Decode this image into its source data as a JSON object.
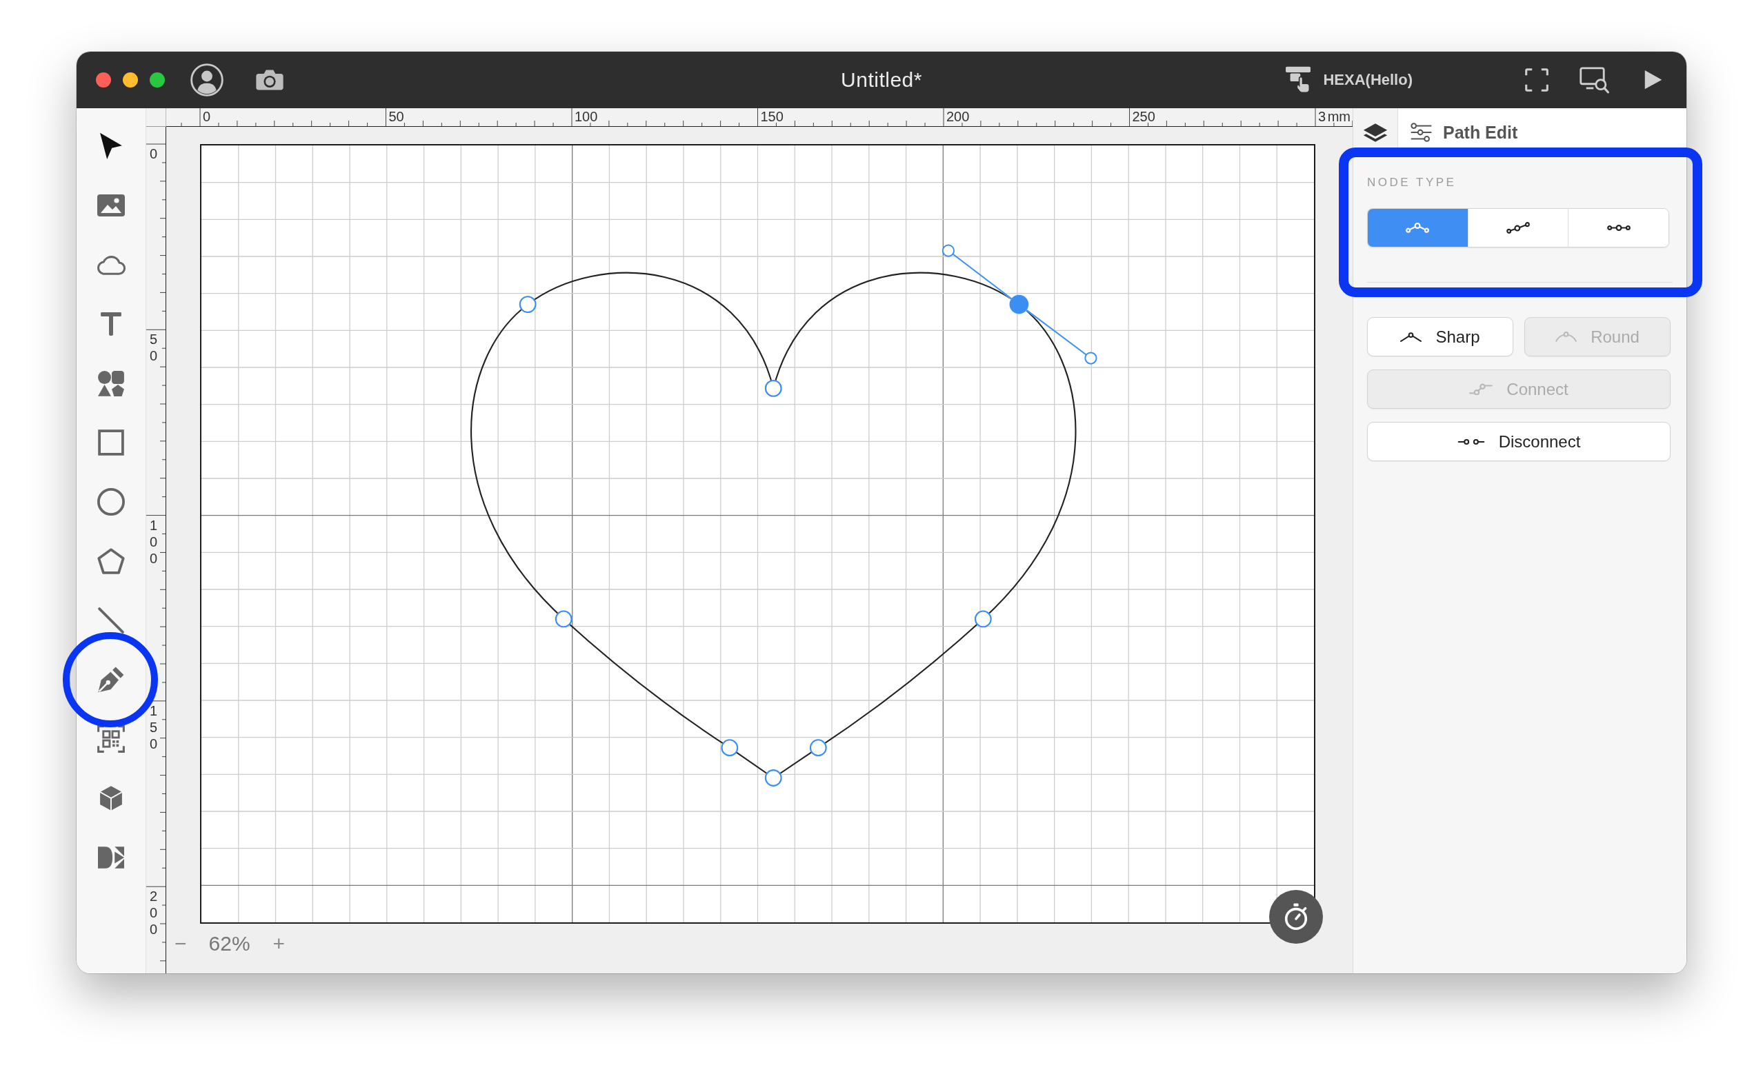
{
  "window": {
    "title": "Untitled*",
    "device": "HEXA(Hello)"
  },
  "tools": [
    {
      "kind": "pointer",
      "highlighted": false
    },
    {
      "kind": "image",
      "highlighted": false
    },
    {
      "kind": "cloud",
      "highlighted": false
    },
    {
      "kind": "text",
      "highlighted": false
    },
    {
      "kind": "shapes",
      "highlighted": false
    },
    {
      "kind": "rectangle",
      "highlighted": false
    },
    {
      "kind": "ellipse",
      "highlighted": false
    },
    {
      "kind": "polygon",
      "highlighted": false
    },
    {
      "kind": "line",
      "highlighted": false
    },
    {
      "kind": "pen",
      "highlighted": true
    },
    {
      "kind": "qrcode",
      "highlighted": false
    },
    {
      "kind": "cube",
      "highlighted": false
    },
    {
      "kind": "logo",
      "highlighted": false
    }
  ],
  "rulers": {
    "top": {
      "labels": [
        "0",
        "50",
        "100",
        "150",
        "200",
        "250",
        "3"
      ],
      "unit": "mm"
    },
    "left": {
      "labels": [
        "0",
        "50",
        "100",
        "150",
        "200"
      ]
    }
  },
  "canvas": {
    "nodes": [
      {
        "selected": false
      },
      {
        "selected": false
      },
      {
        "selected": false
      },
      {
        "selected": false
      },
      {
        "selected": false
      },
      {
        "selected": false
      },
      {
        "selected": false
      },
      {
        "selected": true
      }
    ]
  },
  "zoom": {
    "decrease": "−",
    "value": "62%",
    "increase": "+"
  },
  "panel": {
    "tabs": [
      {
        "kind": "layers",
        "selected": false
      },
      {
        "kind": "path-edit",
        "label": "Path Edit",
        "selected": true
      }
    ],
    "node_type": {
      "title": "NODE TYPE",
      "highlighted": true,
      "options": [
        {
          "kind": "arched",
          "selected": true
        },
        {
          "kind": "slanted",
          "selected": false
        },
        {
          "kind": "straight",
          "selected": false
        }
      ]
    },
    "actions": [
      [
        {
          "kind": "sharp",
          "label": "Sharp",
          "disabled": false
        },
        {
          "kind": "round",
          "label": "Round",
          "disabled": true
        }
      ],
      [
        {
          "kind": "connect",
          "label": "Connect",
          "disabled": true
        }
      ],
      [
        {
          "kind": "disconnect",
          "label": "Disconnect",
          "disabled": false
        }
      ]
    ]
  }
}
